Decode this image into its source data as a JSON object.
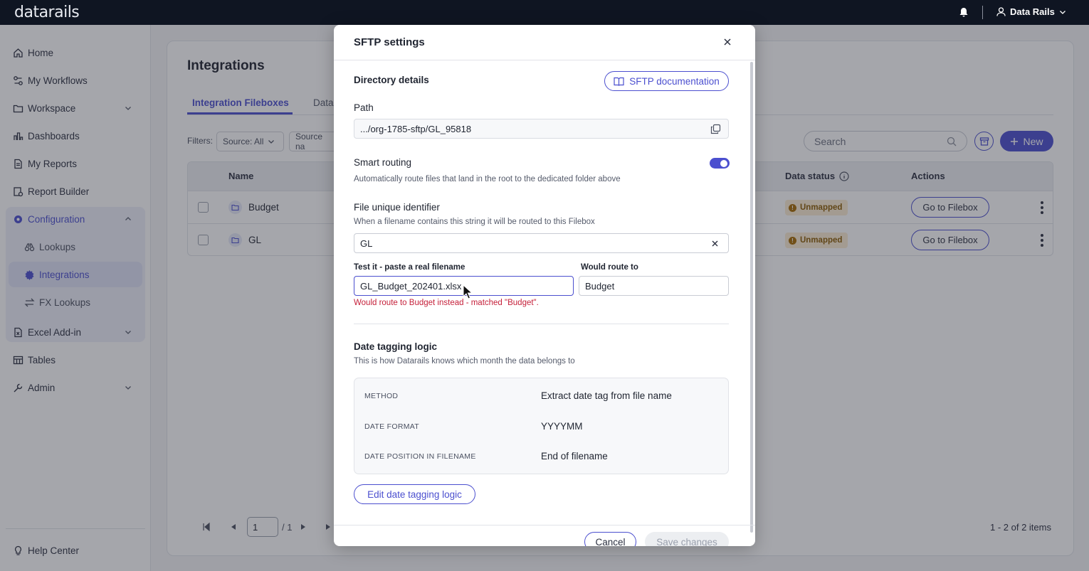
{
  "app": {
    "logo": "datarails",
    "user_name": "Data Rails"
  },
  "sidebar": {
    "items": [
      {
        "label": "Home",
        "icon": "home-icon"
      },
      {
        "label": "My Workflows",
        "icon": "workflow-icon"
      },
      {
        "label": "Workspace",
        "icon": "folder-icon"
      },
      {
        "label": "Dashboards",
        "icon": "chart-icon"
      },
      {
        "label": "My Reports",
        "icon": "document-icon"
      },
      {
        "label": "Report Builder",
        "icon": "report-builder-icon"
      },
      {
        "label": "Configuration",
        "icon": "gear-icon"
      },
      {
        "label": "Excel Add-in",
        "icon": "excel-icon"
      },
      {
        "label": "Tables",
        "icon": "table-icon"
      },
      {
        "label": "Admin",
        "icon": "wrench-icon"
      }
    ],
    "config_sub": [
      {
        "label": "Lookups",
        "icon": "binoculars-icon"
      },
      {
        "label": "Integrations",
        "icon": "gear-icon"
      },
      {
        "label": "FX Lookups",
        "icon": "arrows-swap-icon"
      }
    ],
    "help": "Help Center"
  },
  "page": {
    "title": "Integrations",
    "tabs": [
      "Integration Fileboxes",
      "Data"
    ],
    "filters_label": "Filters:",
    "filter_source": "Source: All",
    "filter_source_name": "Source na",
    "search_placeholder": "Search",
    "new_label": "New",
    "table": {
      "col_name": "Name",
      "col_status": "Data status",
      "col_actions": "Actions",
      "rows": [
        {
          "name": "Budget",
          "status": "Unmapped",
          "action": "Go to Filebox"
        },
        {
          "name": "GL",
          "status": "Unmapped",
          "action": "Go to Filebox"
        }
      ]
    },
    "pager": {
      "page": "1",
      "of": "/ 1",
      "items": "1 - 2 of 2 items"
    }
  },
  "modal": {
    "title": "SFTP settings",
    "directory_title": "Directory details",
    "doc_button": "SFTP documentation",
    "path_label": "Path",
    "path_value": ".../org-1785-sftp/GL_95818",
    "smart_routing_label": "Smart routing",
    "smart_routing_helper": "Automatically route files that land in the root to the dedicated folder above",
    "smart_routing_on": true,
    "identifier_label": "File unique identifier",
    "identifier_helper": "When a filename contains this string it will be routed to this Filebox",
    "identifier_value": "GL",
    "test_label": "Test it - paste a real filename",
    "test_value": "GL_Budget_202401.xlsx",
    "route_label": "Would route to",
    "route_value": "Budget",
    "error_text": "Would route to Budget instead - matched \"Budget\".",
    "date_title": "Date tagging logic",
    "date_helper": "This is how Datarails knows which month the data belongs to",
    "logic": [
      {
        "key": "METHOD",
        "value": "Extract date tag from file name"
      },
      {
        "key": "DATE FORMAT",
        "value": "YYYYMM"
      },
      {
        "key": "DATE POSITION IN FILENAME",
        "value": "End of filename"
      }
    ],
    "edit_button": "Edit date tagging logic",
    "cancel": "Cancel",
    "save": "Save changes"
  },
  "colors": {
    "accent": "#4b4fcf",
    "error": "#c5203a",
    "badge_bg": "#fbecd3"
  }
}
